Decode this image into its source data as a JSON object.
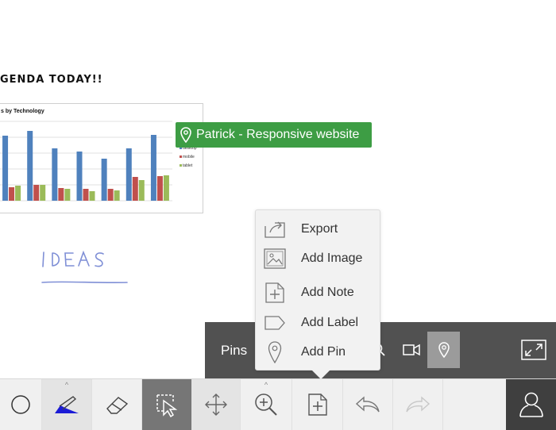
{
  "canvas": {
    "agenda_text": "GENDA TODAY!!",
    "ideas_text": "IDEAS"
  },
  "chart_data": {
    "type": "bar",
    "title": "s by Technology",
    "categories": [
      "1",
      "2",
      "3",
      "4",
      "5",
      "6",
      "7"
    ],
    "series": [
      {
        "name": "desktop",
        "color": "#4f81bd",
        "values": [
          82,
          88,
          66,
          62,
          53,
          66,
          83
        ]
      },
      {
        "name": "mobile",
        "color": "#c0504d",
        "values": [
          17,
          20,
          16,
          15,
          15,
          30,
          31
        ]
      },
      {
        "name": "tablet",
        "color": "#9bbb59",
        "values": [
          19,
          20,
          15,
          12,
          13,
          26,
          32
        ]
      }
    ],
    "ylim": [
      0,
      100
    ],
    "grid": true,
    "legend": "right"
  },
  "pin_label": {
    "text": "Patrick - Responsive website",
    "color": "#3d9d44"
  },
  "pins_panel": {
    "title": "Pins"
  },
  "popup_menu": {
    "items": [
      {
        "label": "Export",
        "icon": "export-icon"
      },
      {
        "label": "Add Image",
        "icon": "image-icon"
      },
      {
        "label": "Add Note",
        "icon": "note-icon"
      },
      {
        "label": "Add Label",
        "icon": "label-icon"
      },
      {
        "label": "Add Pin",
        "icon": "pin-icon"
      }
    ]
  },
  "toolbar": {
    "tools": [
      "circle-tool",
      "pen-tool",
      "eraser-tool",
      "select-tool",
      "move-tool",
      "zoom-tool",
      "add-tool",
      "undo-tool",
      "redo-tool",
      "user-tool"
    ]
  }
}
